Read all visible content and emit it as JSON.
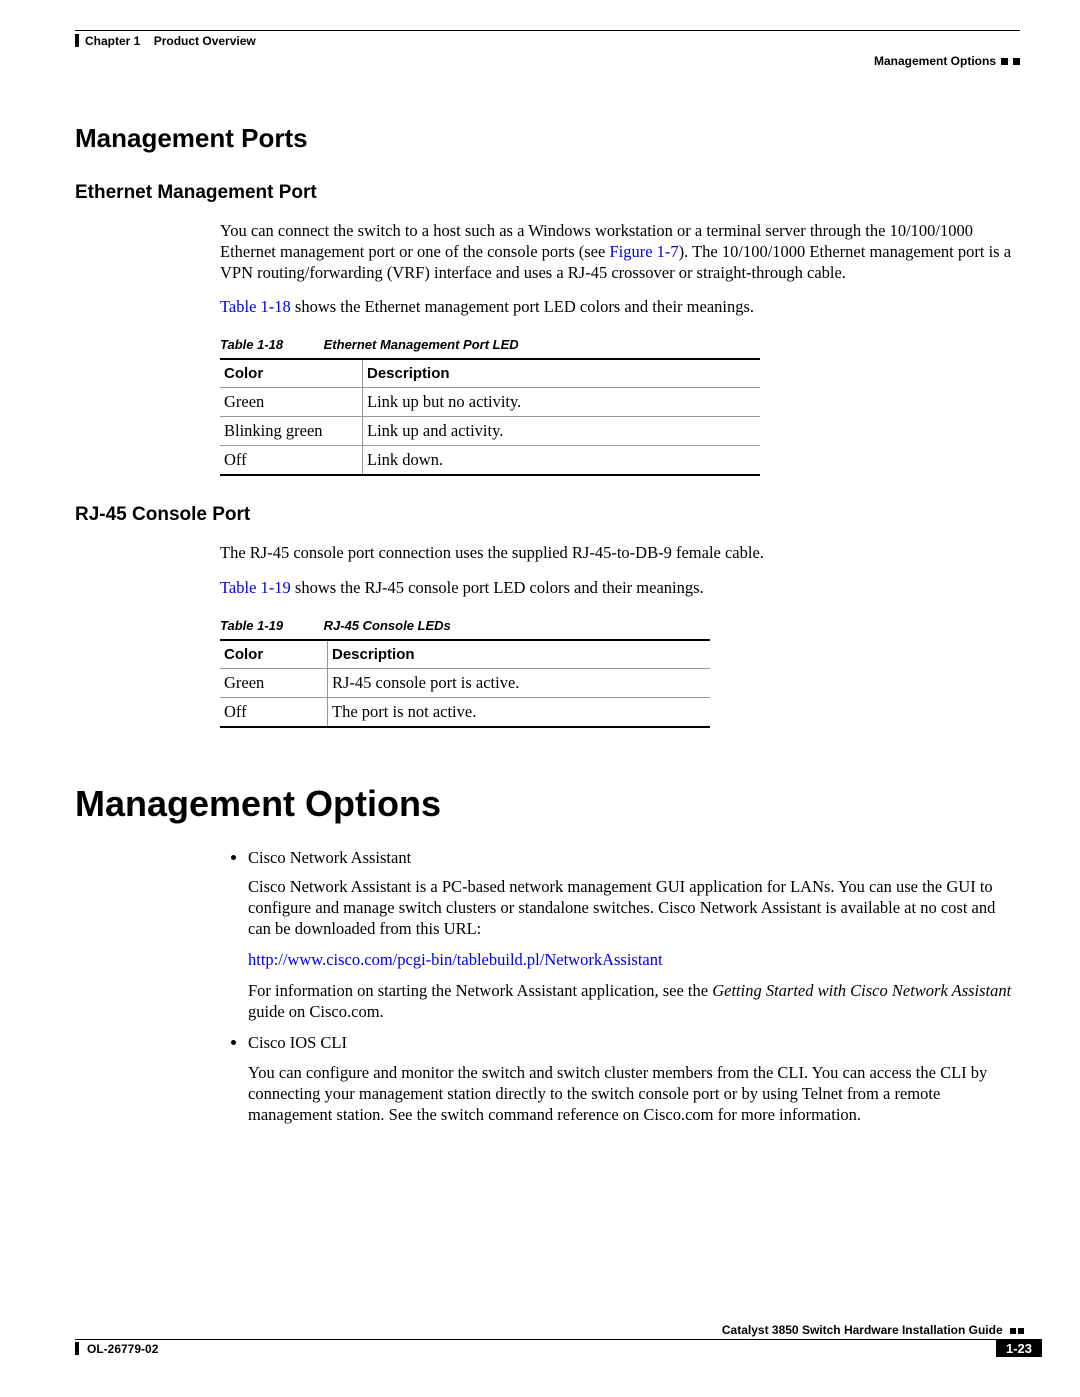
{
  "header": {
    "chapter_label": "Chapter 1",
    "chapter_title": "Product Overview",
    "section": "Management Options"
  },
  "section1": {
    "h2": "Management Ports",
    "sub1": {
      "h3": "Ethernet Management Port",
      "para1_a": "You can connect the switch to a host such as a Windows workstation or a terminal server through the 10/100/1000 Ethernet management port or one of the console ports (see ",
      "para1_link": "Figure 1-7",
      "para1_b": "). The 10/100/1000 Ethernet management port is a VPN routing/forwarding (VRF) interface and uses a RJ-45 crossover or straight-through cable.",
      "para2_link": "Table 1-18",
      "para2_rest": " shows the Ethernet management port LED colors and their meanings.",
      "table": {
        "caption_num": "Table 1-18",
        "caption_title": "Ethernet Management Port LED",
        "col1": "Color",
        "col2": "Description",
        "rows": [
          {
            "c1": "Green",
            "c2": "Link up but no activity."
          },
          {
            "c1": "Blinking green",
            "c2": "Link up and activity."
          },
          {
            "c1": "Off",
            "c2": "Link down."
          }
        ]
      }
    },
    "sub2": {
      "h3": "RJ-45 Console Port",
      "para1": "The RJ-45 console port connection uses the supplied RJ-45-to-DB-9 female cable.",
      "para2_link": "Table 1-19",
      "para2_rest": " shows the RJ-45 console port LED colors and their meanings.",
      "table": {
        "caption_num": "Table 1-19",
        "caption_title": "RJ-45 Console LEDs",
        "col1": "Color",
        "col2": "Description",
        "rows": [
          {
            "c1": "Green",
            "c2": "RJ-45 console port is active."
          },
          {
            "c1": "Off",
            "c2": "The port is not active."
          }
        ]
      }
    }
  },
  "section2": {
    "h1": "Management Options",
    "items": [
      {
        "title": "Cisco Network Assistant",
        "p1": "Cisco Network Assistant is a PC-based network management GUI application for LANs. You can use the GUI to configure and manage switch clusters or standalone switches. Cisco Network Assistant is available at no cost and can be downloaded from this URL:",
        "link": "http://www.cisco.com/pcgi-bin/tablebuild.pl/NetworkAssistant",
        "p2_a": "For information on starting the Network Assistant application, see the ",
        "p2_i": "Getting Started with Cisco Network Assistant",
        "p2_b": " guide on Cisco.com."
      },
      {
        "title": "Cisco IOS CLI",
        "p1": "You can configure and monitor the switch and switch cluster members from the CLI. You can access the CLI by connecting your management station directly to the switch console port or by using Telnet from a remote management station. See the switch command reference on Cisco.com for more information."
      }
    ]
  },
  "footer": {
    "guide": "Catalyst 3850 Switch Hardware Installation Guide",
    "doc_id": "OL-26779-02",
    "page": "1-23"
  }
}
